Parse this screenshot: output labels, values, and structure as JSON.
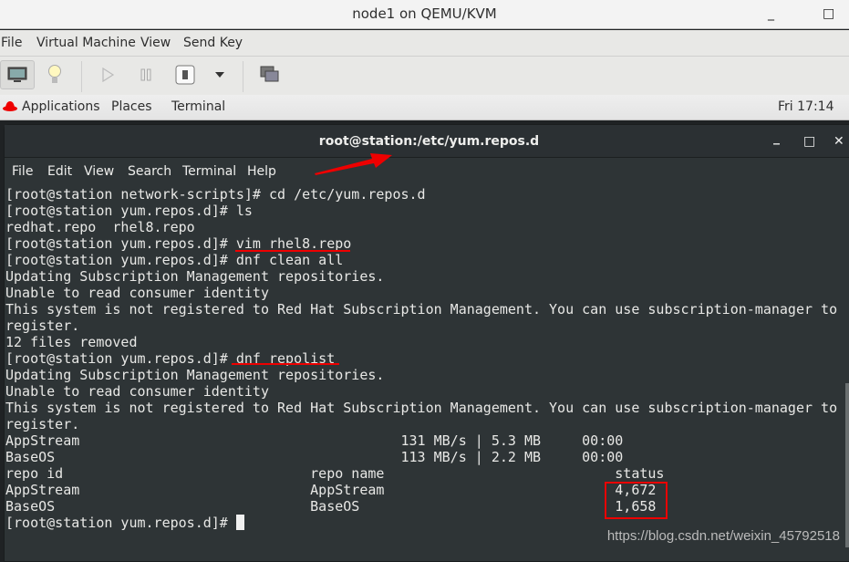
{
  "window": {
    "title": "node1 on QEMU/KVM",
    "minimize": "_",
    "maximize": "□"
  },
  "menubar": [
    "File",
    "Virtual Machine",
    "View",
    "Send Key"
  ],
  "toolbar": {
    "icons": [
      "monitor-icon",
      "lightbulb-icon",
      "play-icon",
      "pause-icon",
      "power-icon",
      "dropdown-icon",
      "screens-icon"
    ]
  },
  "gnome": {
    "applications": "Applications",
    "places": "Places",
    "terminal": "Terminal",
    "clock": "Fri 17:14"
  },
  "terminal": {
    "title": "root@station:/etc/yum.repos.d",
    "controls": {
      "minimize": "_",
      "maximize": "□",
      "close": "✕"
    },
    "menu": [
      "File",
      "Edit",
      "View",
      "Search",
      "Terminal",
      "Help"
    ],
    "lines": [
      "[root@station network-scripts]# cd /etc/yum.repos.d",
      "[root@station yum.repos.d]# ls",
      "redhat.repo  rhel8.repo",
      "[root@station yum.repos.d]# vim rhel8.repo",
      "[root@station yum.repos.d]# dnf clean all",
      "Updating Subscription Management repositories.",
      "Unable to read consumer identity",
      "This system is not registered to Red Hat Subscription Management. You can use subscription-manager to",
      "register.",
      "12 files removed",
      "[root@station yum.repos.d]# dnf repolist",
      "Updating Subscription Management repositories.",
      "Unable to read consumer identity",
      "This system is not registered to Red Hat Subscription Management. You can use subscription-manager to",
      "register.",
      "AppStream                                       131 MB/s | 5.3 MB     00:00",
      "BaseOS                                          113 MB/s | 2.2 MB     00:00",
      "repo id                              repo name                            status",
      "AppStream                            AppStream                            4,672",
      "BaseOS                               BaseOS                               1,658",
      "[root@station yum.repos.d]# "
    ]
  },
  "watermark": "https://blog.csdn.net/weixin_45792518",
  "colors": {
    "annotation": "#ee0000",
    "terminal_bg": "#2e3436"
  }
}
